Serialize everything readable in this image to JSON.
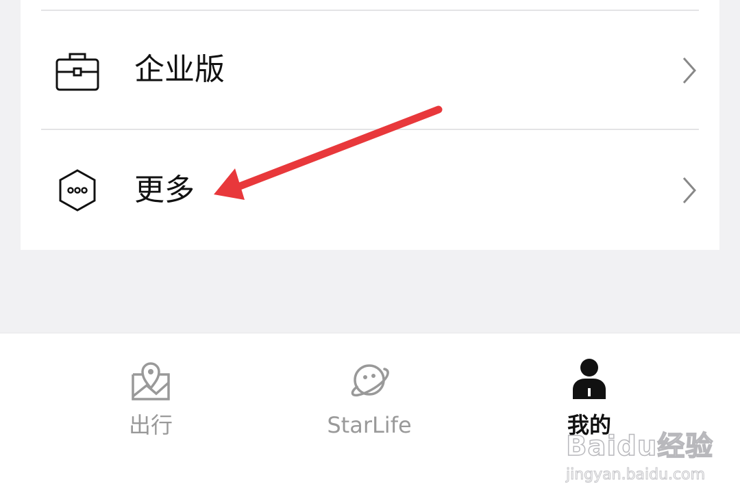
{
  "menu": {
    "items": [
      {
        "label": "企业版",
        "icon": "briefcase-icon"
      },
      {
        "label": "更多",
        "icon": "hexagon-more-icon"
      }
    ]
  },
  "tabbar": {
    "tabs": [
      {
        "label": "出行",
        "icon": "map-pin-icon",
        "active": false
      },
      {
        "label": "StarLife",
        "icon": "planet-icon",
        "active": false
      },
      {
        "label": "我的",
        "icon": "user-icon",
        "active": true
      }
    ]
  },
  "watermark": {
    "brand": "Baidu经验",
    "url": "jingyan.baidu.com"
  },
  "colors": {
    "background": "#f1f1f3",
    "card": "#ffffff",
    "divider": "#e3e3e5",
    "text": "#111111",
    "inactive": "#999999",
    "annotation_arrow": "#e8383b"
  }
}
